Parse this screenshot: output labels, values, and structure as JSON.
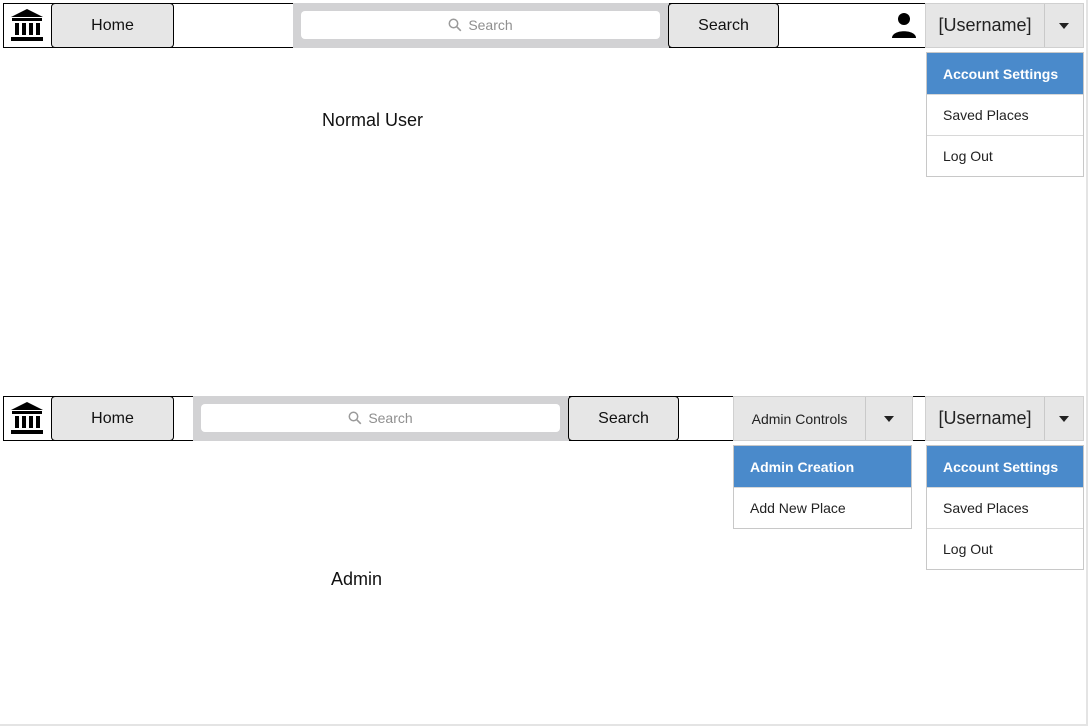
{
  "normal_user": {
    "section_label": "Normal User",
    "nav": {
      "logo_icon": "bank-icon",
      "home_label": "Home",
      "search_placeholder": "Search",
      "search_button_label": "Search",
      "user_icon": "person-icon",
      "username_label": "[Username]"
    },
    "account_menu": {
      "items": [
        "Account Settings",
        "Saved Places",
        "Log Out"
      ],
      "active_index": 0
    }
  },
  "admin": {
    "section_label": "Admin",
    "nav": {
      "logo_icon": "bank-icon",
      "home_label": "Home",
      "search_placeholder": "Search",
      "search_button_label": "Search",
      "admin_controls_label": "Admin Controls",
      "username_label": "[Username]"
    },
    "admin_menu": {
      "items": [
        "Admin Creation",
        "Add New Place"
      ],
      "active_index": 0
    },
    "account_menu": {
      "items": [
        "Account Settings",
        "Saved Places",
        "Log Out"
      ],
      "active_index": 0
    }
  },
  "colors": {
    "accent": "#4a8acb",
    "button_bg": "#e6e6e6",
    "search_bar_bg": "#d2d2d4"
  }
}
